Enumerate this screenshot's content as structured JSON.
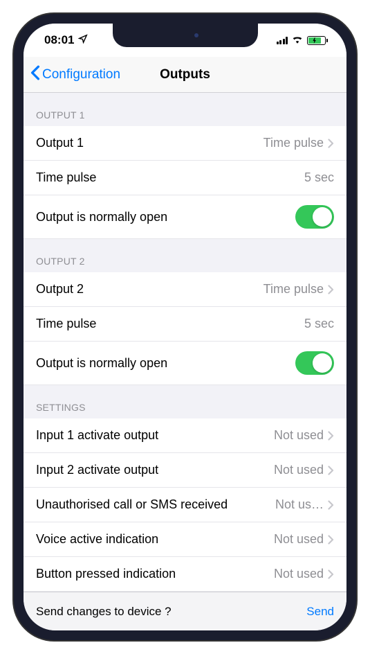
{
  "status": {
    "time": "08:01"
  },
  "nav": {
    "back": "Configuration",
    "title": "Outputs"
  },
  "sections": {
    "output1": {
      "header": "OUTPUT 1",
      "row1_label": "Output 1",
      "row1_value": "Time pulse",
      "row2_label": "Time pulse",
      "row2_value": "5 sec",
      "row3_label": "Output is normally open"
    },
    "output2": {
      "header": "OUTPUT 2",
      "row1_label": "Output 2",
      "row1_value": "Time pulse",
      "row2_label": "Time pulse",
      "row2_value": "5 sec",
      "row3_label": "Output is normally open"
    },
    "settings": {
      "header": "SETTINGS",
      "input1_label": "Input 1 activate output",
      "input1_value": "Not used",
      "input2_label": "Input 2 activate output",
      "input2_value": "Not used",
      "unauth_label": "Unauthorised call or SMS received",
      "unauth_value": "Not us…",
      "voice_label": "Voice active indication",
      "voice_value": "Not used",
      "button_label": "Button pressed indication",
      "button_value": "Not used"
    }
  },
  "footer": {
    "prompt": "Send changes to device ?",
    "action": "Send"
  }
}
